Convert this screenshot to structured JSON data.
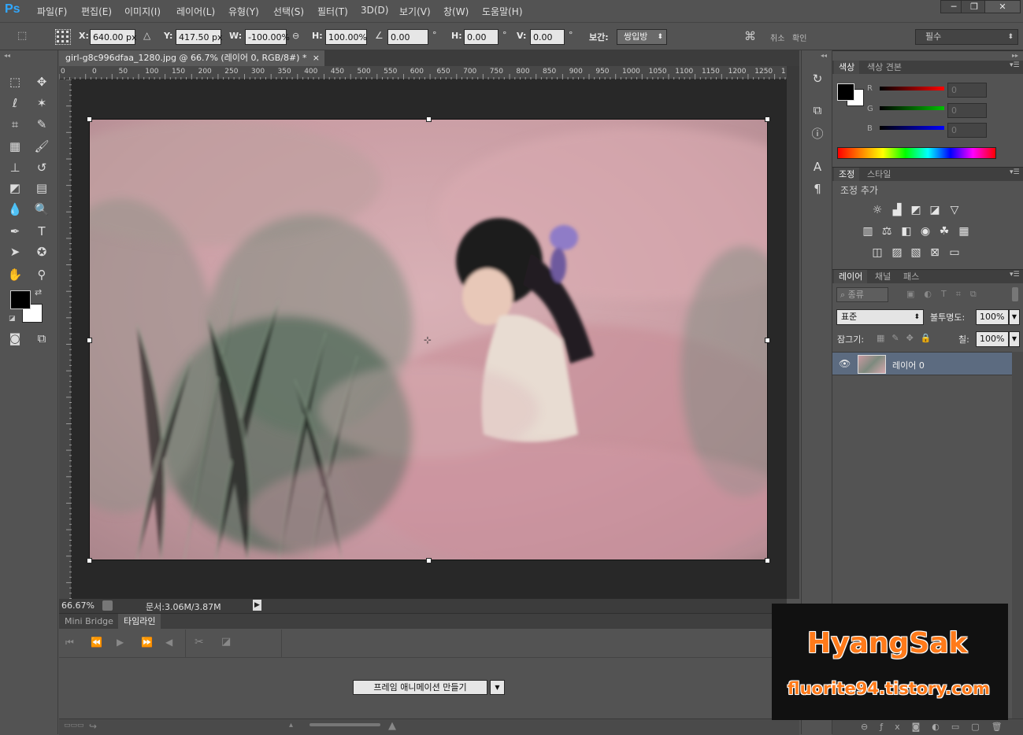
{
  "app": {
    "logo": "Ps"
  },
  "menu": [
    "파일(F)",
    "편집(E)",
    "이미지(I)",
    "레이어(L)",
    "유형(Y)",
    "선택(S)",
    "필터(T)",
    "3D(D)",
    "보기(V)",
    "창(W)",
    "도움말(H)"
  ],
  "window_controls": {
    "minimize": "─",
    "restore": "❐",
    "close": "✕"
  },
  "options": {
    "x_label": "X:",
    "x_value": "640.00 px",
    "y_label": "Y:",
    "y_value": "417.50 px",
    "w_label": "W:",
    "w_value": "-100.00%",
    "h_label": "H:",
    "h_value": "100.00%",
    "angle_value": "0.00",
    "hskew_label": "H:",
    "hskew_value": "0.00",
    "vskew_label": "V:",
    "vskew_value": "0.00",
    "deg": "°",
    "interp_label": "보간:",
    "interp_value": "쌍입방",
    "cancel": "취소",
    "commit": "확인",
    "workspace": "필수"
  },
  "document": {
    "tab_title": "girl-g8c996dfaa_1280.jpg @ 66.7% (레이어 0, RGB/8#) *",
    "close": "×",
    "ruler_ticks": [
      "0",
      "0",
      "50",
      "100",
      "150",
      "200",
      "250",
      "300",
      "350",
      "400",
      "450",
      "500",
      "550",
      "600",
      "650",
      "700",
      "750",
      "800",
      "850",
      "900",
      "950",
      "1000",
      "1050",
      "1100",
      "1150",
      "1200",
      "1250",
      "1"
    ]
  },
  "status": {
    "zoom": "66.67%",
    "doc_size": "문서:3.06M/3.87M"
  },
  "timeline": {
    "tabs": [
      "Mini Bridge",
      "타임라인"
    ],
    "create_button": "프레임 애니메이션 만들기"
  },
  "color_panel": {
    "tabs": [
      "색상",
      "색상 견본"
    ],
    "channels": [
      {
        "label": "R",
        "value": "0",
        "color": "#ff0000"
      },
      {
        "label": "G",
        "value": "0",
        "color": "#00c000"
      },
      {
        "label": "B",
        "value": "0",
        "color": "#0000ff"
      }
    ]
  },
  "adjust_panel": {
    "tabs": [
      "조정",
      "스타일"
    ],
    "title": "조정 추가"
  },
  "layers_panel": {
    "tabs": [
      "레이어",
      "채널",
      "패스"
    ],
    "kind": "종류",
    "blend_mode": "표준",
    "opacity_label": "불투명도:",
    "opacity": "100%",
    "lock_label": "잠그기:",
    "fill_label": "칠:",
    "fill": "100%",
    "layers": [
      {
        "name": "레이어 0"
      }
    ]
  },
  "watermark": {
    "title": "HyangSak",
    "url": "fluorite94.tistory.com"
  }
}
